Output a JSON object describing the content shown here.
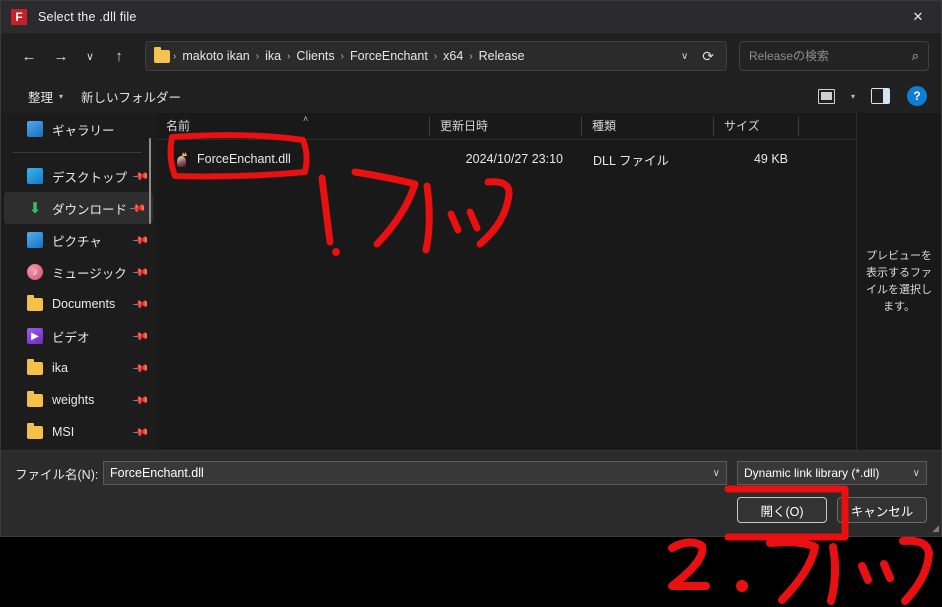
{
  "window": {
    "title": "Select the .dll file",
    "app_icon": "F",
    "close_label": "✕",
    "accent_red": "#c5202a",
    "annotation_color": "#e81010"
  },
  "nav": {
    "back": "←",
    "forward": "→",
    "recent": "∨",
    "up": "↑",
    "dropdown": "∨",
    "refresh": "⟳",
    "breadcrumbs": [
      "makoto ikan",
      "ika",
      "Clients",
      "ForceEnchant",
      "x64",
      "Release"
    ],
    "separator": "›"
  },
  "search": {
    "placeholder": "Releaseの検索",
    "value": "",
    "icon": "⌕"
  },
  "command_bar": {
    "organize": "整理",
    "new_folder": "新しいフォルダー",
    "caret": "▾",
    "help": "?"
  },
  "sidebar": {
    "items": [
      {
        "label": "ギャラリー",
        "icon": "gallery",
        "pinned": false,
        "selected": false
      },
      {
        "label": "デスクトップ",
        "icon": "desktop",
        "pinned": true,
        "selected": false
      },
      {
        "label": "ダウンロード",
        "icon": "download",
        "pinned": true,
        "selected": true
      },
      {
        "label": "ピクチャ",
        "icon": "picture",
        "pinned": true,
        "selected": false
      },
      {
        "label": "ミュージック",
        "icon": "music",
        "pinned": true,
        "selected": false
      },
      {
        "label": "Documents",
        "icon": "folder",
        "pinned": true,
        "selected": false
      },
      {
        "label": "ビデオ",
        "icon": "video",
        "pinned": true,
        "selected": false
      },
      {
        "label": "ika",
        "icon": "folder",
        "pinned": true,
        "selected": false
      },
      {
        "label": "weights",
        "icon": "folder",
        "pinned": true,
        "selected": false
      },
      {
        "label": "MSI",
        "icon": "folder",
        "pinned": true,
        "selected": false
      }
    ],
    "pin_glyph": "📌"
  },
  "file_list": {
    "columns": [
      "名前",
      "更新日時",
      "種類",
      "サイズ"
    ],
    "sort_indicator": "˄",
    "rows": [
      {
        "name": "ForceEnchant.dll",
        "date": "2024/10/27 23:10",
        "type": "DLL ファイル",
        "size": "49 KB"
      }
    ]
  },
  "preview": {
    "message": "プレビューを表示するファイルを選択します。"
  },
  "bottom": {
    "filename_label": "ファイル名(N):",
    "filename_value": "ForceEnchant.dll",
    "filter_value": "Dynamic link library (*.dll)",
    "chevron": "∨",
    "open_button": "開く(O)",
    "cancel_button": "キャンセル",
    "resize_grip": "◢"
  },
  "annotations": [
    {
      "id": "circle-file",
      "kind": "ink-rectangle",
      "text": ""
    },
    {
      "id": "step-1",
      "kind": "handwriting",
      "text": "1. クリック"
    },
    {
      "id": "circle-open-button",
      "kind": "ink-rectangle",
      "text": ""
    },
    {
      "id": "step-2",
      "kind": "handwriting",
      "text": "2. クリック"
    }
  ]
}
